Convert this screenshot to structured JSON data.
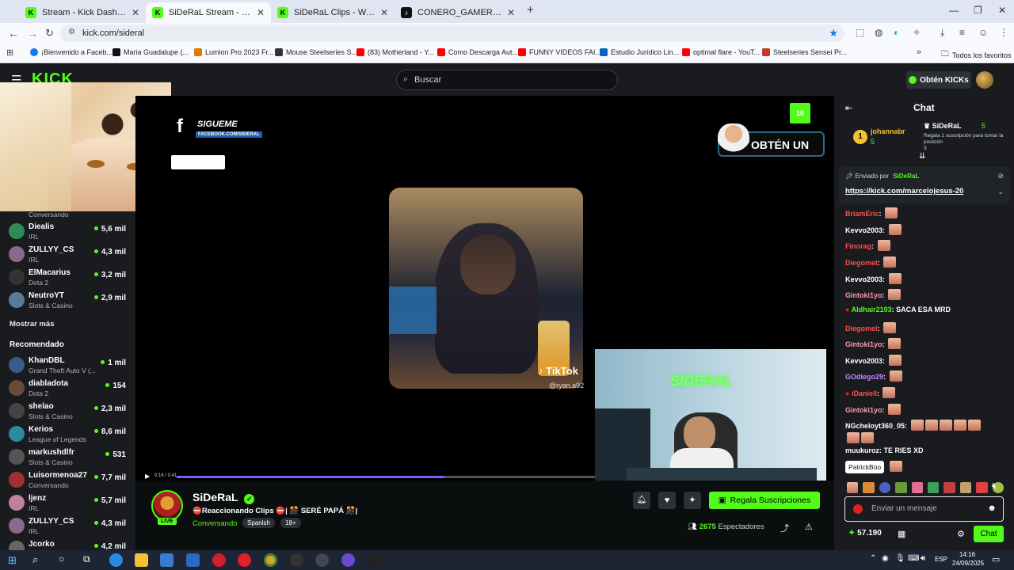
{
  "browser": {
    "tabs": [
      {
        "title": "Stream - Kick Dashboard",
        "icon": "kick-icon"
      },
      {
        "title": "SiDeRaL Stream - Watch Live",
        "icon": "kick-icon"
      },
      {
        "title": "SiDeRaL Clips - Watch Live on K",
        "icon": "kick-icon"
      },
      {
        "title": "CONERO_GAMER (@conero_g",
        "icon": "tiktok-icon"
      }
    ],
    "url": "kick.com/sideral",
    "bookmarks": [
      {
        "label": "¡Bienvenido a Faceb...",
        "color": "#1877f2"
      },
      {
        "label": "Maria Guadalupe (...",
        "color": "#111111"
      },
      {
        "label": "Lumion Pro 2023 Fr...",
        "color": "#e07a00"
      },
      {
        "label": "Mouse Steelseries S...",
        "color": "#333333"
      },
      {
        "label": "(83) Motherland - Y...",
        "color": "#ff0000"
      },
      {
        "label": "Como Descarga Aut...",
        "color": "#ff0000"
      },
      {
        "label": "FUNNY VIDEOS FAI...",
        "color": "#ff0000"
      },
      {
        "label": "Estudio Jurídico Lin...",
        "color": "#0a66c2"
      },
      {
        "label": "optimal flare - YouT...",
        "color": "#ff0000"
      },
      {
        "label": "Steelseries Sensei Pr...",
        "color": "#c0392b"
      }
    ],
    "all_favorites": "Todos los favoritos"
  },
  "header": {
    "logo": "KICK",
    "search_placeholder": "Buscar",
    "get_kicks": "Obtén KICKs"
  },
  "sidebar": {
    "top_partial_category": "Conversando",
    "following": [
      {
        "name": "Diealis",
        "category": "IRL",
        "viewers": "5,6 mil",
        "color": "#2e8b57"
      },
      {
        "name": "ZULLYY_CS",
        "category": "IRL",
        "viewers": "4,3 mil",
        "color": "#8a6a8a"
      },
      {
        "name": "ElMacarius",
        "category": "Dota 2",
        "viewers": "3,2 mil",
        "color": "#333333"
      },
      {
        "name": "NeutroYT",
        "category": "Slots & Casino",
        "viewers": "2,9 mil",
        "color": "#5a7a9a"
      }
    ],
    "show_more": "Mostrar más",
    "recommended_title": "Recomendado",
    "recommended": [
      {
        "name": "KhanDBL",
        "category": "Grand Theft Auto V (...",
        "viewers": "1 mil",
        "color": "#3a5a8a"
      },
      {
        "name": "diabladota",
        "category": "Dota 2",
        "viewers": "154",
        "color": "#6a4a3a"
      },
      {
        "name": "shelao",
        "category": "Slots & Casino",
        "viewers": "2,3 mil",
        "color": "#444444"
      },
      {
        "name": "Kerios",
        "category": "League of Legends",
        "viewers": "8,6 mil",
        "color": "#2a8aa0"
      },
      {
        "name": "markushdlfr",
        "category": "Slots & Casino",
        "viewers": "531",
        "color": "#555555"
      },
      {
        "name": "Luisormenoa27",
        "category": "Conversando",
        "viewers": "7,7 mil",
        "color": "#a03030"
      },
      {
        "name": "ljenz",
        "category": "IRL",
        "viewers": "5,7 mil",
        "color": "#c080a0"
      },
      {
        "name": "ZULLYY_CS",
        "category": "IRL",
        "viewers": "4,3 mil",
        "color": "#8a6a8a"
      },
      {
        "name": "Jcorko",
        "category": "",
        "viewers": "4,2 mil",
        "color": "#666666"
      }
    ]
  },
  "video": {
    "overlay_follow_title": "SIGUEME",
    "overlay_follow_sub": "FACEBOOK.COM/SIDERAL",
    "overlay_banner": "OBTÉN UN",
    "tiktok_label": "TikTok",
    "tiktok_user": "@ryan.a92",
    "webcam_sign": "SIDERAL",
    "time": "0:16 / 0:41",
    "progress": 0.64
  },
  "stream": {
    "channel": "SiDeRaL",
    "live_badge": "LIVE",
    "title": "⛔Reaccionando Clips ⛔| 🎊 SERÉ PAPÁ 🎊|",
    "category": "Conversando",
    "tags": [
      "Spanish",
      "18+"
    ],
    "subscribe_button": "Regala Suscripciones",
    "viewers": "2675",
    "viewers_label": "Espectadores"
  },
  "chat": {
    "title": "Chat",
    "leader_rank": "1",
    "leader_name": "johannabr",
    "leader_count": "5",
    "gift_name": "SiDeRaL",
    "gift_count": "5",
    "gift_text": "Regala 1 suscripción para tomar la posición",
    "gift_position": "3",
    "pinned_by": "Enviado por",
    "pinned_user": "SiDeRaL",
    "pinned_link": "https://kick.com/marcelojesus-20",
    "messages": [
      {
        "user": "BriamEric",
        "text": "",
        "color": "#ff4d4d",
        "emotes": 1
      },
      {
        "user": "Kevvo2003",
        "text": "",
        "color": "#ffffff",
        "emotes": 1
      },
      {
        "user": "Finorag",
        "text": "",
        "color": "#ff4d4d",
        "emotes": 1
      },
      {
        "user": "Diegomel",
        "text": "",
        "color": "#ff4d4d",
        "emotes": 1
      },
      {
        "user": "Kevvo2003",
        "text": "",
        "color": "#ffffff",
        "emotes": 1
      },
      {
        "user": "Gintoki1yo",
        "text": "",
        "color": "#ff9ab0",
        "emotes": 1
      },
      {
        "user": "Aldhair2103",
        "text": "SACA ESA MRD",
        "color": "#53fc18",
        "emotes": 0
      },
      {
        "user": "Diegomel",
        "text": "",
        "color": "#ff4d4d",
        "emotes": 1
      },
      {
        "user": "Gintoki1yo",
        "text": "",
        "color": "#ff9ab0",
        "emotes": 1
      },
      {
        "user": "Kevvo2003",
        "text": "",
        "color": "#ffffff",
        "emotes": 1
      },
      {
        "user": "GOdiego29",
        "text": "",
        "color": "#c08cff",
        "emotes": 1
      },
      {
        "user": "iDaniell",
        "text": "",
        "color": "#ff4d4d",
        "emotes": 1
      },
      {
        "user": "Gintoki1yo",
        "text": "",
        "color": "#ff9ab0",
        "emotes": 1
      },
      {
        "user": "NGcheloyt360_05",
        "text": "",
        "color": "#ffffff",
        "emotes": 6
      },
      {
        "user": "muukuroz",
        "text": "TE RIES XD",
        "color": "#ffffff",
        "emotes": 0
      }
    ],
    "tooltip": "PatrickBoo",
    "input_placeholder": "Enviar un mensaje",
    "kicks": "57.190",
    "send_button": "Chat"
  },
  "taskbar": {
    "lang": "ESP",
    "time": "14:16",
    "date": "24/09/2025"
  }
}
